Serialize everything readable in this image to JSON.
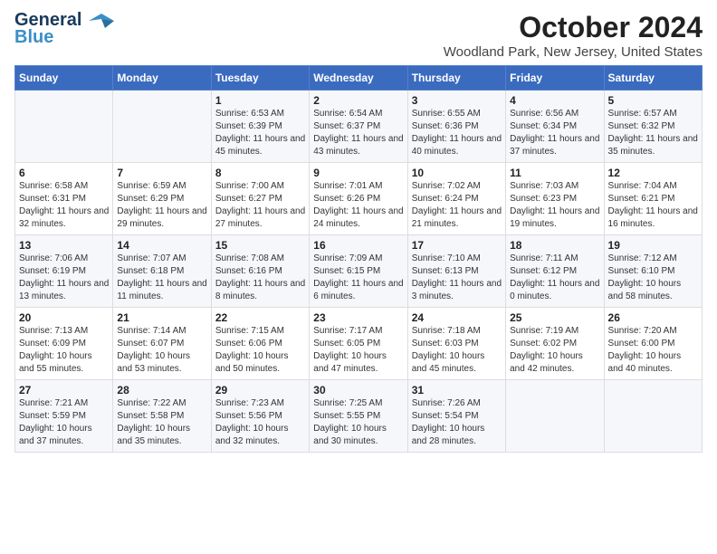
{
  "header": {
    "logo_line1": "General",
    "logo_line2": "Blue",
    "title": "October 2024",
    "subtitle": "Woodland Park, New Jersey, United States"
  },
  "days_of_week": [
    "Sunday",
    "Monday",
    "Tuesday",
    "Wednesday",
    "Thursday",
    "Friday",
    "Saturday"
  ],
  "weeks": [
    [
      {
        "num": "",
        "info": ""
      },
      {
        "num": "",
        "info": ""
      },
      {
        "num": "1",
        "info": "Sunrise: 6:53 AM\nSunset: 6:39 PM\nDaylight: 11 hours and 45 minutes."
      },
      {
        "num": "2",
        "info": "Sunrise: 6:54 AM\nSunset: 6:37 PM\nDaylight: 11 hours and 43 minutes."
      },
      {
        "num": "3",
        "info": "Sunrise: 6:55 AM\nSunset: 6:36 PM\nDaylight: 11 hours and 40 minutes."
      },
      {
        "num": "4",
        "info": "Sunrise: 6:56 AM\nSunset: 6:34 PM\nDaylight: 11 hours and 37 minutes."
      },
      {
        "num": "5",
        "info": "Sunrise: 6:57 AM\nSunset: 6:32 PM\nDaylight: 11 hours and 35 minutes."
      }
    ],
    [
      {
        "num": "6",
        "info": "Sunrise: 6:58 AM\nSunset: 6:31 PM\nDaylight: 11 hours and 32 minutes."
      },
      {
        "num": "7",
        "info": "Sunrise: 6:59 AM\nSunset: 6:29 PM\nDaylight: 11 hours and 29 minutes."
      },
      {
        "num": "8",
        "info": "Sunrise: 7:00 AM\nSunset: 6:27 PM\nDaylight: 11 hours and 27 minutes."
      },
      {
        "num": "9",
        "info": "Sunrise: 7:01 AM\nSunset: 6:26 PM\nDaylight: 11 hours and 24 minutes."
      },
      {
        "num": "10",
        "info": "Sunrise: 7:02 AM\nSunset: 6:24 PM\nDaylight: 11 hours and 21 minutes."
      },
      {
        "num": "11",
        "info": "Sunrise: 7:03 AM\nSunset: 6:23 PM\nDaylight: 11 hours and 19 minutes."
      },
      {
        "num": "12",
        "info": "Sunrise: 7:04 AM\nSunset: 6:21 PM\nDaylight: 11 hours and 16 minutes."
      }
    ],
    [
      {
        "num": "13",
        "info": "Sunrise: 7:06 AM\nSunset: 6:19 PM\nDaylight: 11 hours and 13 minutes."
      },
      {
        "num": "14",
        "info": "Sunrise: 7:07 AM\nSunset: 6:18 PM\nDaylight: 11 hours and 11 minutes."
      },
      {
        "num": "15",
        "info": "Sunrise: 7:08 AM\nSunset: 6:16 PM\nDaylight: 11 hours and 8 minutes."
      },
      {
        "num": "16",
        "info": "Sunrise: 7:09 AM\nSunset: 6:15 PM\nDaylight: 11 hours and 6 minutes."
      },
      {
        "num": "17",
        "info": "Sunrise: 7:10 AM\nSunset: 6:13 PM\nDaylight: 11 hours and 3 minutes."
      },
      {
        "num": "18",
        "info": "Sunrise: 7:11 AM\nSunset: 6:12 PM\nDaylight: 11 hours and 0 minutes."
      },
      {
        "num": "19",
        "info": "Sunrise: 7:12 AM\nSunset: 6:10 PM\nDaylight: 10 hours and 58 minutes."
      }
    ],
    [
      {
        "num": "20",
        "info": "Sunrise: 7:13 AM\nSunset: 6:09 PM\nDaylight: 10 hours and 55 minutes."
      },
      {
        "num": "21",
        "info": "Sunrise: 7:14 AM\nSunset: 6:07 PM\nDaylight: 10 hours and 53 minutes."
      },
      {
        "num": "22",
        "info": "Sunrise: 7:15 AM\nSunset: 6:06 PM\nDaylight: 10 hours and 50 minutes."
      },
      {
        "num": "23",
        "info": "Sunrise: 7:17 AM\nSunset: 6:05 PM\nDaylight: 10 hours and 47 minutes."
      },
      {
        "num": "24",
        "info": "Sunrise: 7:18 AM\nSunset: 6:03 PM\nDaylight: 10 hours and 45 minutes."
      },
      {
        "num": "25",
        "info": "Sunrise: 7:19 AM\nSunset: 6:02 PM\nDaylight: 10 hours and 42 minutes."
      },
      {
        "num": "26",
        "info": "Sunrise: 7:20 AM\nSunset: 6:00 PM\nDaylight: 10 hours and 40 minutes."
      }
    ],
    [
      {
        "num": "27",
        "info": "Sunrise: 7:21 AM\nSunset: 5:59 PM\nDaylight: 10 hours and 37 minutes."
      },
      {
        "num": "28",
        "info": "Sunrise: 7:22 AM\nSunset: 5:58 PM\nDaylight: 10 hours and 35 minutes."
      },
      {
        "num": "29",
        "info": "Sunrise: 7:23 AM\nSunset: 5:56 PM\nDaylight: 10 hours and 32 minutes."
      },
      {
        "num": "30",
        "info": "Sunrise: 7:25 AM\nSunset: 5:55 PM\nDaylight: 10 hours and 30 minutes."
      },
      {
        "num": "31",
        "info": "Sunrise: 7:26 AM\nSunset: 5:54 PM\nDaylight: 10 hours and 28 minutes."
      },
      {
        "num": "",
        "info": ""
      },
      {
        "num": "",
        "info": ""
      }
    ]
  ]
}
